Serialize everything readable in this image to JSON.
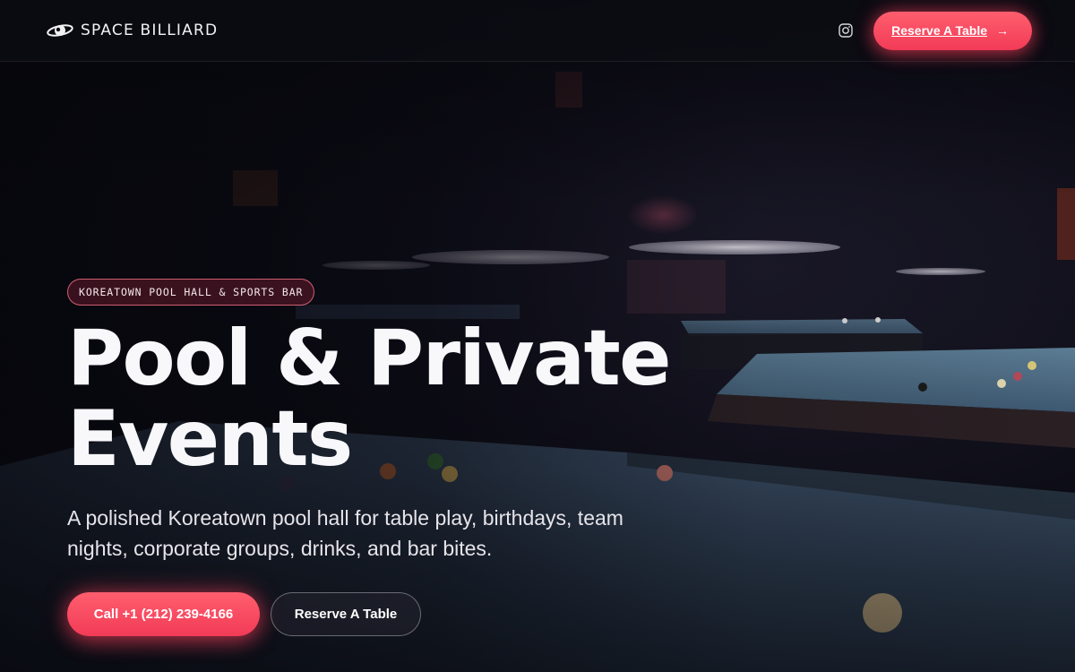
{
  "brand": {
    "name": "SPACE BILLIARD",
    "logo_icon": "saturn-logo-icon"
  },
  "header": {
    "instagram_icon": "instagram-icon",
    "cta_label": "Reserve A Table",
    "cta_icon": "arrow-right-icon"
  },
  "hero": {
    "eyebrow": "KOREATOWN POOL HALL & SPORTS BAR",
    "title_line1": "Pool & Private",
    "title_line2": "Events",
    "subtitle": "A polished Koreatown pool hall for table play, birthdays, team nights, corporate groups, drinks, and bar bites.",
    "call_button": "Call +1 (212) 239-4166",
    "reserve_button": "Reserve A Table"
  },
  "colors": {
    "accent": "#f23b57",
    "accent_light": "#ff5e6e",
    "background": "#0b0b12"
  }
}
